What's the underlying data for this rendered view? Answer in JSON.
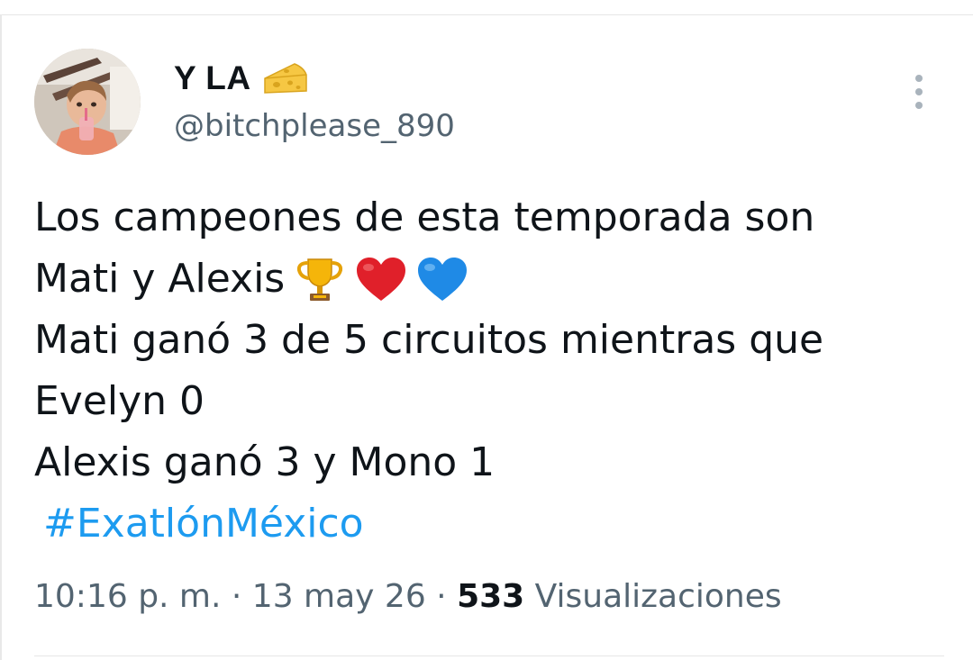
{
  "author": {
    "display_name": "Y LA",
    "badge_icon": "cheese-wedge-icon",
    "handle": "@bitchplease_890"
  },
  "tweet": {
    "lines": [
      "Los campeones de esta temporada son",
      "Mati y Alexis",
      "Mati ganó 3 de 5 circuitos mientras que",
      "Evelyn 0",
      "Alexis ganó 3 y Mono 1"
    ],
    "emojis": [
      "trophy-icon",
      "red-heart-icon",
      "blue-heart-icon"
    ],
    "hashtag": "#ExatlónMéxico"
  },
  "meta": {
    "time": "10:16 p. m.",
    "separator": " · ",
    "date": "13 may 26",
    "views_count": "533",
    "views_label": " Visualizaciones"
  },
  "colors": {
    "text": "#0f1419",
    "secondary": "#536471",
    "link": "#1d9bf0"
  }
}
